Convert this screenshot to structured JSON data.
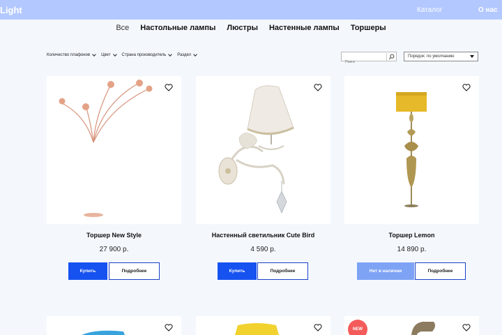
{
  "header": {
    "logo": "Light",
    "nav": {
      "catalog": "Каталог",
      "about": "О нас"
    }
  },
  "tabs": [
    "Все",
    "Настольные лампы",
    "Люстры",
    "Настенные лампы",
    "Торшеры"
  ],
  "filters": [
    "Количество плафонов",
    "Цвет",
    "Страна производитель",
    "Раздел"
  ],
  "search": {
    "placeholder": "Поиск"
  },
  "sort": {
    "label": "Порядок: по умолчанию"
  },
  "buttons": {
    "buy": "Купить",
    "details": "Подробнее",
    "not_available": "Нет в наличии"
  },
  "products": [
    {
      "name": "Торшер New Style",
      "price": "27 900 р.",
      "available": true
    },
    {
      "name": "Настенный светильник Cute Bird",
      "price": "4 590 р.",
      "available": true
    },
    {
      "name": "Торшер Lemon",
      "price": "14 890 р.",
      "available": false
    }
  ],
  "badges": {
    "new": "NEW"
  },
  "colors": {
    "header": "#b3c8ff",
    "primary": "#1652f0",
    "disabled": "#7ea3f5",
    "background": "#f4f8fd"
  }
}
